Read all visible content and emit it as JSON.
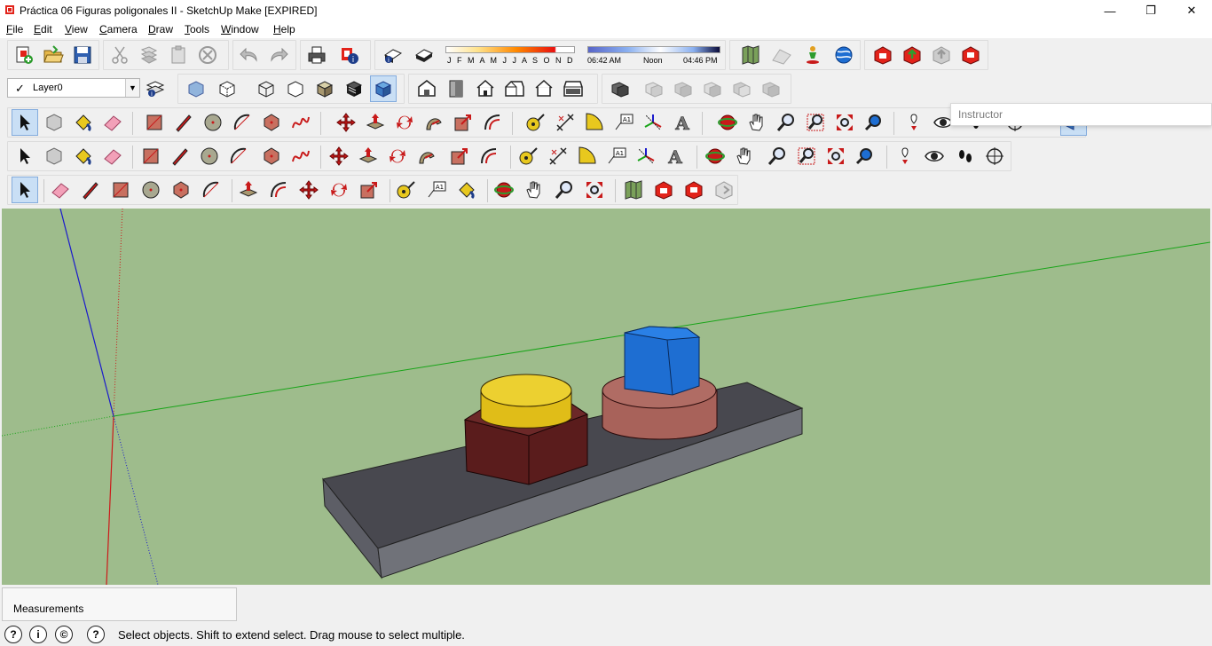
{
  "window": {
    "title": "Práctica 06 Figuras poligonales II - SketchUp Make [EXPIRED]",
    "app_icon": "sketchup-logo-icon",
    "minimize_icon": "minimize-icon",
    "restore_icon": "restore-icon",
    "close_icon": "close-icon"
  },
  "menu": [
    {
      "label": "File",
      "acc": "F",
      "rest": "ile"
    },
    {
      "label": "Edit",
      "acc": "E",
      "rest": "dit"
    },
    {
      "label": "View",
      "acc": "V",
      "rest": "iew"
    },
    {
      "label": "Camera",
      "acc": "C",
      "rest": "amera"
    },
    {
      "label": "Draw",
      "acc": "D",
      "rest": "raw"
    },
    {
      "label": "Tools",
      "acc": "T",
      "rest": "ools"
    },
    {
      "label": "Window",
      "acc": "W",
      "rest": "indow"
    },
    {
      "label": "Help",
      "acc": "H",
      "rest": "elp"
    }
  ],
  "toolbar": {
    "layer": {
      "checked_mark": "✓",
      "name": "Layer0",
      "dropdown_icon": "chevron-down-icon"
    },
    "shadow_months": "J F M A M J J A S O N D",
    "time_start": "06:42 AM",
    "time_noon": "Noon",
    "time_end": "04:46 PM"
  },
  "instructor": {
    "label": "Instructor"
  },
  "measurements": {
    "label": "Measurements",
    "value": ""
  },
  "status": {
    "text": "Select objects. Shift to extend select. Drag mouse to select multiple.",
    "geo_icon": "geolocation-icon",
    "credits_icon": "credits-icon",
    "license_icon": "license-icon",
    "help_icon": "help-icon",
    "geo_glyph": "?",
    "credits_glyph": "i",
    "license_glyph": "©",
    "help_glyph": "?"
  },
  "colors": {
    "viewport_bg": "#9ebc8c",
    "blue_axis": "#1a1acc",
    "green_axis": "#18a418",
    "red_axis": "#cc1a1a",
    "base_top": "#4a4a52",
    "base_front": "#6c6e75",
    "yellow_cylinder": "#e8c81e",
    "dark_prism": "#5a1c1c",
    "pink_cylinder": "#a8625a",
    "blue_prism": "#1e6ed2"
  }
}
